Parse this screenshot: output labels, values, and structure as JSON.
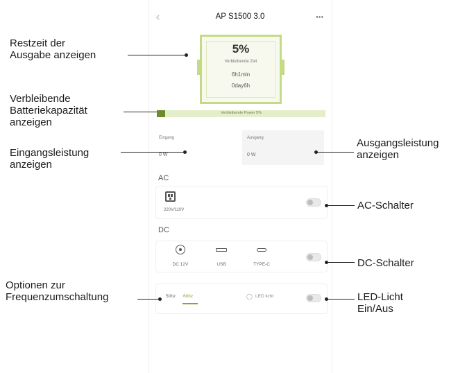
{
  "app": {
    "title": "AP S1500 3.0",
    "back_icon": "chevron-left-icon",
    "more_icon": "more-icon"
  },
  "battery": {
    "percent": "5%",
    "remaining_label": "Verbleibende Zeit",
    "time": "6h1min",
    "days": "0day6h"
  },
  "capacity_bar": {
    "label": "Verbleibende Power 5%",
    "fill_fraction": 0.05,
    "color": "#6b8c2a"
  },
  "power": {
    "input_label": "Eingang",
    "input_value": "0 W",
    "output_label": "Ausgang",
    "output_value": "0 W"
  },
  "ac": {
    "section_label": "AC",
    "outlet_icon": "ac-outlet-icon",
    "voltage": "220V/110V",
    "toggle_on": false
  },
  "dc": {
    "section_label": "DC",
    "items": [
      "DC 12V",
      "USB",
      "TYPE-C"
    ],
    "toggle_on": false
  },
  "frequency": {
    "options": [
      "50hz",
      "60hz"
    ],
    "selected": "60hz",
    "led_label": "LED licht",
    "led_icon": "bulb-icon",
    "led_on": false
  },
  "annotations": {
    "remaining_time_line1": "Restzeit der",
    "remaining_time_line2": "Ausgabe anzeigen",
    "capacity_line1": "Verbleibende",
    "capacity_line2": "Batteriekapazität",
    "capacity_line3": "anzeigen",
    "input_line1": "Eingangsleistung",
    "input_line2": "anzeigen",
    "output_line1": "Ausgangsleistung",
    "output_line2": "anzeigen",
    "ac_switch": "AC-Schalter",
    "dc_switch": "DC-Schalter",
    "freq_line1": "Optionen zur",
    "freq_line2": "Frequenzumschaltung",
    "led_line1": "LED-Licht",
    "led_line2": "Ein/Aus"
  },
  "colors": {
    "accent_green": "#c5da86",
    "dark_green": "#6b8c2a",
    "selected_freq": "#8aa437"
  }
}
